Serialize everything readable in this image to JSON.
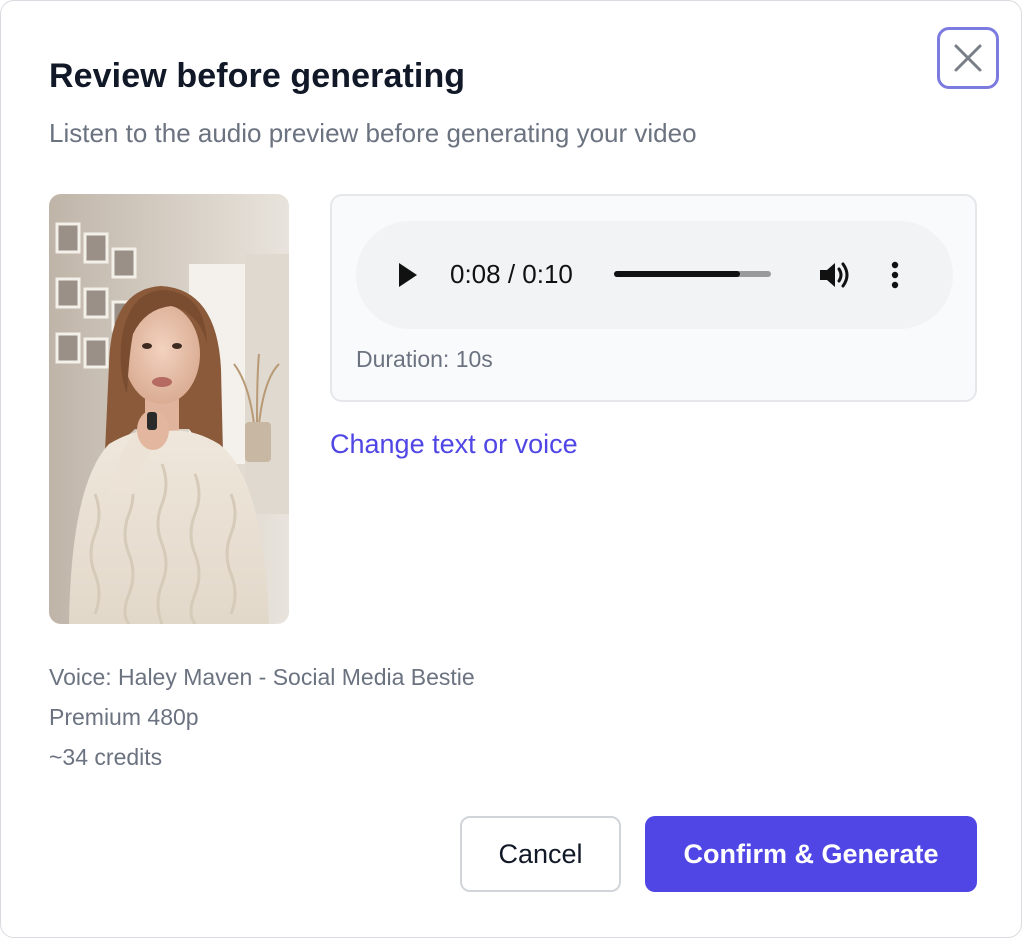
{
  "dialog": {
    "title": "Review before generating",
    "subtitle": "Listen to the audio preview before generating your video",
    "close_icon": "close-icon"
  },
  "preview": {
    "image_alt": "avatar-preview"
  },
  "audio": {
    "current_time": "0:08",
    "total_time": "0:10",
    "time_display": "0:08 / 0:10",
    "progress_fraction": 0.8,
    "duration_label": "Duration: 10s",
    "icons": [
      "play-icon",
      "volume-icon",
      "more-vertical-icon"
    ]
  },
  "change_link": "Change text or voice",
  "details": {
    "voice": "Voice: Haley Maven - Social Media Bestie",
    "quality": "Premium 480p",
    "credits": "~34 credits"
  },
  "actions": {
    "cancel_label": "Cancel",
    "confirm_label": "Confirm & Generate"
  },
  "colors": {
    "accent": "#4f46e5",
    "close_border": "#7c7be0",
    "text_primary": "#111827",
    "text_secondary": "#6b7280"
  }
}
